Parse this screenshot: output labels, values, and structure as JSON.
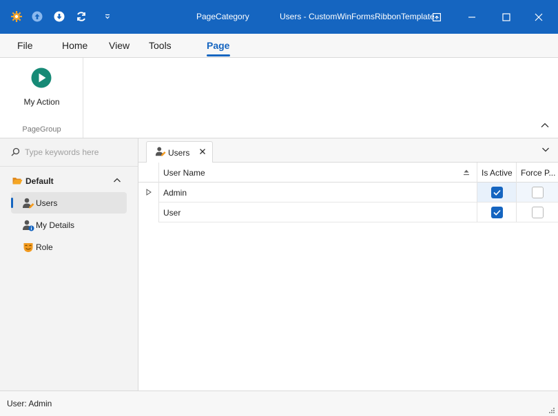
{
  "titlebar": {
    "category": "PageCategory",
    "title": "Users - CustomWinFormsRibbonTemplate",
    "quick_access": [
      "settings-icon",
      "upload-icon",
      "download-icon",
      "refresh-icon",
      "customize-qat-icon"
    ],
    "controls": [
      "window-menu-icon",
      "minimize-icon",
      "maximize-icon",
      "close-icon"
    ]
  },
  "ribbon": {
    "tabs": [
      {
        "label": "File"
      },
      {
        "label": "Home"
      },
      {
        "label": "View"
      },
      {
        "label": "Tools"
      },
      {
        "label": "Page",
        "active": true
      }
    ],
    "group": {
      "action_label": "My Action",
      "action_icon": "play-icon",
      "group_label": "PageGroup"
    }
  },
  "nav": {
    "search": {
      "placeholder": "Type keywords here",
      "value": ""
    },
    "group_label": "Default",
    "items": [
      {
        "label": "Users",
        "icon": "user-edit-icon",
        "selected": true
      },
      {
        "label": "My Details",
        "icon": "user-info-icon"
      },
      {
        "label": "Role",
        "icon": "role-mask-icon"
      }
    ]
  },
  "document": {
    "tab_label": "Users",
    "grid": {
      "columns": [
        "User Name",
        "Is Active",
        "Force P..."
      ],
      "rows": [
        {
          "user_name": "Admin",
          "is_active": true,
          "force_password": false
        },
        {
          "user_name": "User",
          "is_active": true,
          "force_password": false
        }
      ]
    }
  },
  "status": {
    "text": "User: Admin"
  },
  "colors": {
    "accent": "#1565c0",
    "action_green": "#168a76"
  }
}
